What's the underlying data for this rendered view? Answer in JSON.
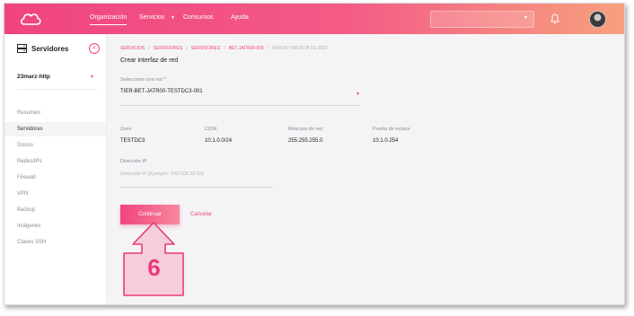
{
  "topbar": {
    "nav": [
      "Organización",
      "Servicios",
      "Consumos",
      "Ayuda"
    ],
    "colors": {
      "gradient_start": "#f0447f",
      "gradient_end": "#f7a07c",
      "accent": "#f0447f"
    },
    "icons": [
      "cloud-logo-icon",
      "chevron-down-icon",
      "bell-icon",
      "user-avatar"
    ]
  },
  "sidebar": {
    "title": "Servidores",
    "collapse_icon": "«",
    "project": "23marz-http",
    "items": [
      "Resumen",
      "Servidores",
      "Discos",
      "Redes/IPs",
      "Firewall",
      "VPN",
      "Backup",
      "Imágenes",
      "Claves SSH"
    ],
    "active_index": 1
  },
  "breadcrumb": [
    "SERVICIOS",
    "SERVIDORES",
    "SERVIDORES",
    "BET-JATR00-009",
    "AÑADIR TARJETA DE RED"
  ],
  "page_title": "Crear interfaz de red",
  "network_select": {
    "label": "Seleccione una red *",
    "value": "TIER-BET-JATR00-TESTDC3-001"
  },
  "info": [
    {
      "label": "Zone",
      "value": "TESTDC3"
    },
    {
      "label": "CIDR",
      "value": "10.1.0.0/24"
    },
    {
      "label": "Máscara de red",
      "value": "255.255.255.0"
    },
    {
      "label": "Puerta de enlace",
      "value": "10.1.0.254"
    }
  ],
  "ip_field": {
    "label": "Dirección IP",
    "placeholder": "Dirección IP (Ejemplo: 192.168.32.10)"
  },
  "actions": {
    "continue": "Continuar",
    "cancel": "Cancelar"
  },
  "annotation": {
    "step_number": "6",
    "arrow_color": "#e83a7a",
    "box_fill": "#f6cddb"
  }
}
